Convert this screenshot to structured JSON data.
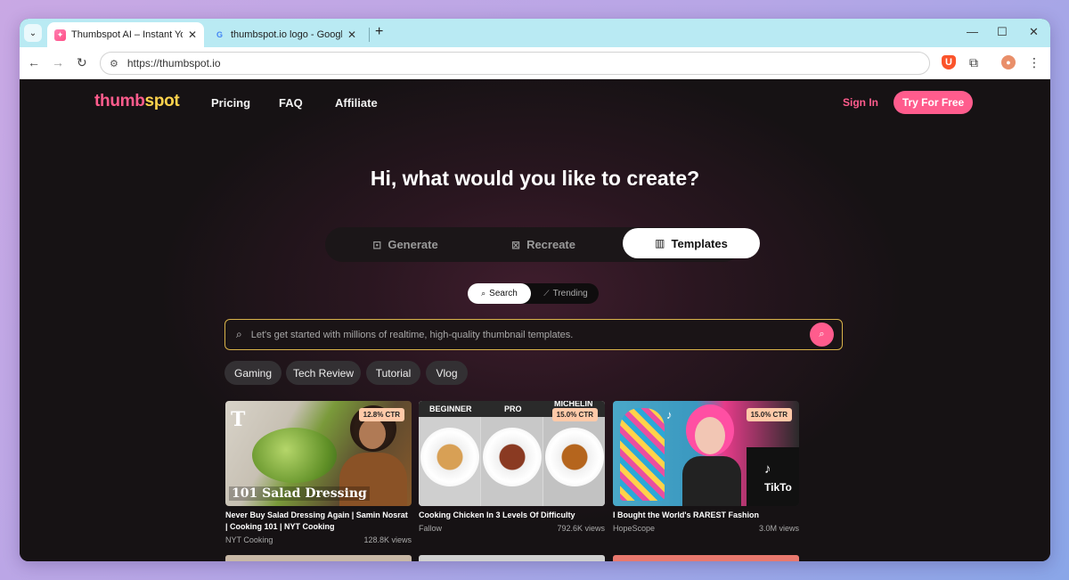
{
  "browser": {
    "tabs": [
      {
        "title": "Thumbspot AI – Instant YouTub",
        "active": true
      },
      {
        "title": "thumbspot.io logo - Google Se",
        "active": false
      }
    ],
    "url": "https://thumbspot.io"
  },
  "site": {
    "logo_part1": "thumb",
    "logo_part2": "spot",
    "nav": [
      "Pricing",
      "FAQ",
      "Affiliate"
    ],
    "sign_in": "Sign In",
    "try_free": "Try For Free",
    "headline": "Hi, what would you like to create?",
    "modes": [
      "Generate",
      "Recreate",
      "Templates"
    ],
    "active_mode": "Templates",
    "submodes": [
      "Search",
      "Trending"
    ],
    "active_submode": "Search",
    "search_placeholder": "Let's get started with millions of realtime, high-quality thumbnail templates.",
    "chips": [
      "Gaming",
      "Tech Review",
      "Tutorial",
      "Vlog"
    ],
    "cards": [
      {
        "ctr": "12.8% CTR",
        "overlay": "101 Salad Dressing",
        "title": "Never Buy Salad Dressing Again | Samin Nosrat | Cooking 101 | NYT Cooking",
        "channel": "NYT Cooking",
        "views": "128.8K views"
      },
      {
        "ctr": "15.0% CTR",
        "overlay_labels": [
          "BEGINNER",
          "PRO",
          "MICHELIN"
        ],
        "title": "Cooking Chicken In 3 Levels Of Difficulty",
        "channel": "Fallow",
        "views": "792.6K views"
      },
      {
        "ctr": "15.0% CTR",
        "overlay": "TikTo",
        "title": "I Bought the World's RAREST Fashion",
        "channel": "HopeScope",
        "views": "3.0M views"
      }
    ]
  },
  "colors": {
    "accent": "#ff5c8d",
    "logo_yellow": "#ffd34d",
    "search_border": "#d9b34a"
  }
}
